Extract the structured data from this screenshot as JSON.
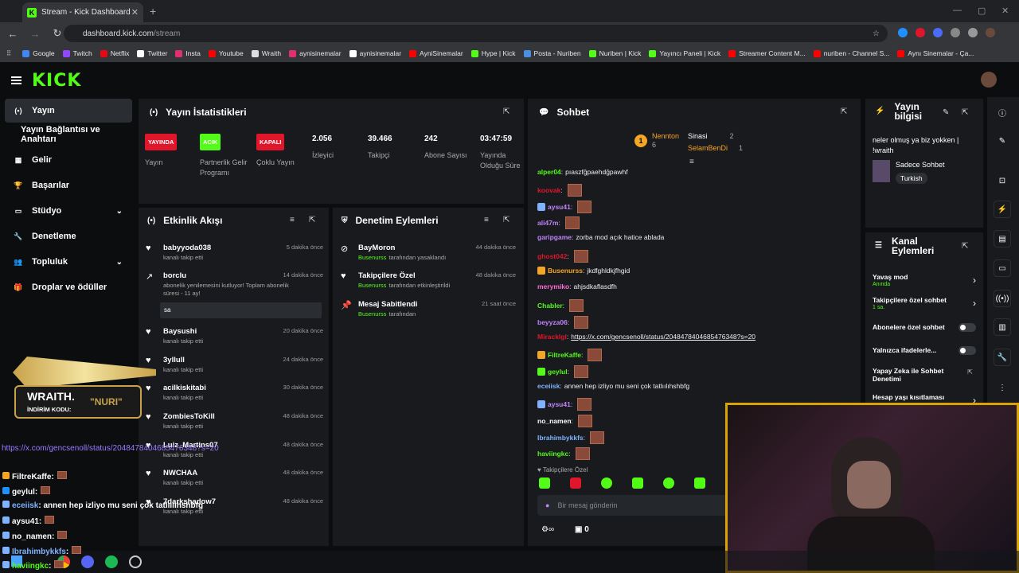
{
  "browser": {
    "tab_title": "Stream - Kick Dashboard",
    "url_domain": "dashboard.kick.com",
    "url_path": "/stream"
  },
  "bookmarks": [
    {
      "label": "Google",
      "color": "#4285f4"
    },
    {
      "label": "Twitch",
      "color": "#9146ff"
    },
    {
      "label": "Netflix",
      "color": "#e50914"
    },
    {
      "label": "Twitter",
      "color": "#ffffff"
    },
    {
      "label": "Insta",
      "color": "#e1306c"
    },
    {
      "label": "Youtube",
      "color": "#ff0000"
    },
    {
      "label": "Wraith",
      "color": "#dddddd"
    },
    {
      "label": "aynisinemalar",
      "color": "#e1306c"
    },
    {
      "label": "aynisinemalar",
      "color": "#ffffff"
    },
    {
      "label": "AyniSinemalar",
      "color": "#ff0000"
    },
    {
      "label": "Hype | Kick",
      "color": "#53fc18"
    },
    {
      "label": "Posta - Nuriben",
      "color": "#4a90e2"
    },
    {
      "label": "Nuriben | Kick",
      "color": "#53fc18"
    },
    {
      "label": "Yayıncı Paneli | Kick",
      "color": "#53fc18"
    },
    {
      "label": "Streamer Content M...",
      "color": "#ff0000"
    },
    {
      "label": "nuriben - Channel S...",
      "color": "#ff0000"
    },
    {
      "label": "Aynı Sinemalar - Ça...",
      "color": "#ff0000"
    }
  ],
  "logo": "KICK",
  "sidebar": [
    {
      "label": "Yayın",
      "icon": "broadcast-icon"
    },
    {
      "label": "Yayın Bağlantısı ve Anahtarı",
      "icon": ""
    },
    {
      "label": "Gelir",
      "icon": "chart-icon"
    },
    {
      "label": "Başarılar",
      "icon": "trophy-icon"
    },
    {
      "label": "Stüdyo",
      "icon": "studio-icon"
    },
    {
      "label": "Denetleme",
      "icon": "wrench-icon"
    },
    {
      "label": "Topluluk",
      "icon": "community-icon"
    },
    {
      "label": "Droplar ve ödüller",
      "icon": "gift-icon"
    }
  ],
  "stats": {
    "title": "Yayın İstatistikleri",
    "items": [
      {
        "badge": "YAYINDA",
        "badge_color": "#e0162b",
        "label": "Yayın"
      },
      {
        "badge": "ACIK",
        "badge_color": "#53fc18",
        "label": "Partnerlik Gelir Programı"
      },
      {
        "badge": "KAPALI",
        "badge_color": "#e0162b",
        "label": "Çoklu Yayın"
      },
      {
        "value": "2.056",
        "label": "İzleyici"
      },
      {
        "value": "39.466",
        "label": "Takipçi"
      },
      {
        "value": "242",
        "label": "Abone Sayısı"
      },
      {
        "value": "03:47:59",
        "label": "Yayında Olduğu Süre"
      }
    ]
  },
  "activity": {
    "title": "Etkinlik Akışı",
    "items": [
      {
        "name": "babyyoda038",
        "sub": "kanalı takip etti",
        "time": "5 dakika önce"
      },
      {
        "name": "borclu",
        "sub": "abonelik yenilemesini kutluyor! Toplam abonelik süresi - 11 ay!",
        "time": "14 dakika önce",
        "msg": "sa"
      },
      {
        "name": "Baysushi",
        "sub": "kanalı takip etti",
        "time": "20 dakika önce"
      },
      {
        "name": "3yllull",
        "sub": "kanalı takip etti",
        "time": "24 dakika önce"
      },
      {
        "name": "acilkiskitabi",
        "sub": "kanalı takip etti",
        "time": "30 dakika önce"
      },
      {
        "name": "ZombiesToKill",
        "sub": "kanalı takip etti",
        "time": "48 dakika önce"
      },
      {
        "name": "Luiz_Martins07",
        "sub": "kanalı takip etti",
        "time": "48 dakika önce"
      },
      {
        "name": "NWCHAA",
        "sub": "kanalı takip etti",
        "time": "48 dakika önce"
      },
      {
        "name": "7darkshadow7",
        "sub": "kanalı takip etti",
        "time": "48 dakika önce"
      }
    ]
  },
  "moderation": {
    "title": "Denetim Eylemleri",
    "items": [
      {
        "name": "BayMoron",
        "by": "Busenurss",
        "sub": "tarafından yasaklandı",
        "time": "44 dakika önce"
      },
      {
        "name": "Takipçilere Özel",
        "by": "Busenurss",
        "sub": "tarafından etkinleştirildi",
        "time": "48 dakika önce"
      },
      {
        "name": "Mesaj Sabitlendi",
        "by": "Busenurss",
        "sub": "tarafından",
        "time": "21 saat önce"
      }
    ]
  },
  "chat": {
    "title": "Sohbet",
    "top": [
      {
        "name": "Nennton",
        "count": "6"
      },
      {
        "name": "Sinasi",
        "count": "2"
      },
      {
        "name": "SelamBenDi",
        "count": "1"
      }
    ],
    "messages": [
      {
        "user": "alper04",
        "color": "#53fc18",
        "text": "pıaszfğpaehdğpawhf",
        "emote": false
      },
      {
        "user": "koovak",
        "color": "#e0162b",
        "text": "",
        "emote": true
      },
      {
        "user": "aysu41",
        "color": "#c084fc",
        "text": "",
        "emote": true
      },
      {
        "user": "ali47m",
        "color": "#c084fc",
        "text": "",
        "emote": true
      },
      {
        "user": "garipgame",
        "color": "#c084fc",
        "text": "zorba mod açık hatice ablada",
        "emote": false
      },
      {
        "user": "ghost042",
        "color": "#e0162b",
        "text": "",
        "emote": true
      },
      {
        "user": "Busenurss",
        "color": "#f5a623",
        "text": "jkdfghldkjfhgid",
        "emote": false
      },
      {
        "user": "merymiko",
        "color": "#ff6bd6",
        "text": "ahjsdkaflasdfh",
        "emote": false
      },
      {
        "user": "Chabler",
        "color": "#53fc18",
        "text": "",
        "emote": true
      },
      {
        "user": "beyyza06",
        "color": "#c084fc",
        "text": "",
        "emote": true
      },
      {
        "user": "Miracklgl",
        "color": "#e0162b",
        "text": "https://x.com/gencsenoll/status/2048478404685476348?s=20",
        "emote": false
      },
      {
        "user": "FiltreKaffe",
        "color": "#53fc18",
        "text": "",
        "emote": true
      },
      {
        "user": "geylul",
        "color": "#53fc18",
        "text": "",
        "emote": true
      },
      {
        "user": "eceiisk",
        "color": "#7fb3ff",
        "text": "annen hep izliyo mu seni çok tatlıılıhshbfg",
        "emote": false
      },
      {
        "user": "aysu41",
        "color": "#c084fc",
        "text": "",
        "emote": true
      },
      {
        "user": "no_namen",
        "color": "#ffffff",
        "text": "",
        "emote": true
      },
      {
        "user": "Ibrahimbykkfs",
        "color": "#7fb3ff",
        "text": "",
        "emote": true
      },
      {
        "user": "haviingkc",
        "color": "#53fc18",
        "text": "",
        "emote": true
      }
    ],
    "follower_only": "Takipçilere Özel",
    "placeholder": "Bir mesaj gönderin",
    "count": "0"
  },
  "stream_info": {
    "title": "Yayın bilgisi",
    "text": "neler olmuş ya biz yokken | !wraith",
    "category": "Sadece Sohbet",
    "tag": "Turkish"
  },
  "channel_actions": {
    "title": "Kanal Eylemleri",
    "items": [
      {
        "label": "Yavaş mod",
        "sub": "Anında",
        "kind": "arrow"
      },
      {
        "label": "Takipçilere özel sohbet",
        "sub": "1 sa.",
        "kind": "arrow"
      },
      {
        "label": "Abonelere özel sohbet",
        "sub": "",
        "kind": "toggle"
      },
      {
        "label": "Yalnızca ifadelerle...",
        "sub": "",
        "kind": "toggle"
      },
      {
        "label": "Yapay Zeka ile Sohbet Denetimi",
        "sub": "",
        "kind": "link"
      },
      {
        "label": "Hesap yaşı kısıtlaması",
        "sub": "",
        "kind": "arrow"
      }
    ]
  },
  "overlay": {
    "logo_text": "WRAITH.",
    "code_label": "İNDİRİM KODU:",
    "code": "\"NURI\"",
    "chat": [
      {
        "user": "",
        "text": "https://x.com/gencsenoll/status/2048478404685476348?s=20",
        "color": "#9b7bff"
      },
      {
        "user": "FiltreKaffe",
        "text": ":",
        "color": "#fff"
      },
      {
        "user": "geylul",
        "text": ":",
        "color": "#fff"
      },
      {
        "user": "eceiisk",
        "text": ": annen hep izliyo mu seni çok tatlıılıhshbfg",
        "color": "#7fb3ff"
      },
      {
        "user": "aysu41",
        "text": ":",
        "color": "#fff"
      },
      {
        "user": "no_namen",
        "text": ":",
        "color": "#fff"
      },
      {
        "user": "Ibrahimbykkfs",
        "text": ":",
        "color": "#7fb3ff"
      },
      {
        "user": "haviingkc",
        "text": ":",
        "color": "#53fc18"
      }
    ]
  }
}
